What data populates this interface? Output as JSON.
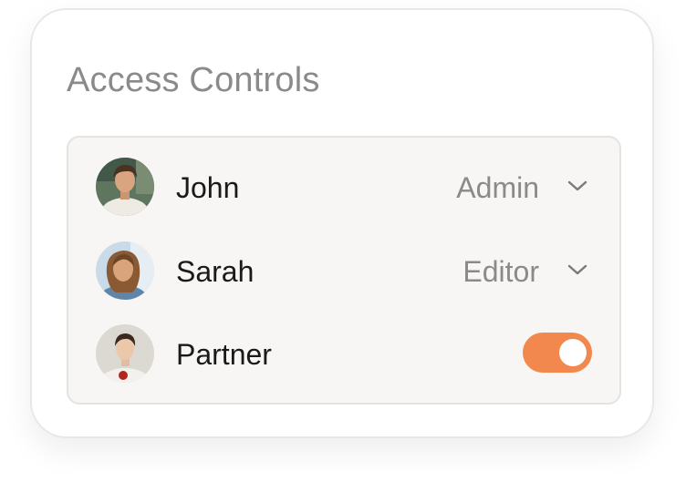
{
  "card": {
    "title": "Access Controls"
  },
  "members": [
    {
      "name": "John",
      "role": "Admin",
      "avatar_icon": "user-avatar-john"
    },
    {
      "name": "Sarah",
      "role": "Editor",
      "avatar_icon": "user-avatar-sarah"
    },
    {
      "name": "Partner",
      "toggle_on": true,
      "avatar_icon": "user-avatar-partner"
    }
  ],
  "colors": {
    "toggle_on": "#f2884e",
    "title": "#8a8a8a",
    "name": "#1a1a1a",
    "role": "#8a8a8a",
    "panel_bg": "#f7f6f4"
  },
  "icons": {
    "dropdown": "chevron-down-icon"
  }
}
